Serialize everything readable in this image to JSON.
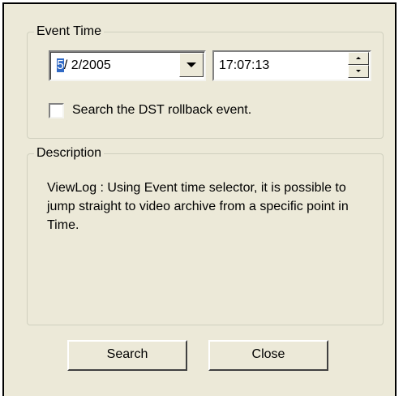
{
  "event_time": {
    "group_label": "Event Time",
    "date": {
      "month": "5",
      "rest": "/ 2/2005"
    },
    "time": "17:07:13",
    "dst_checkbox": {
      "label": "Search the DST rollback event.",
      "checked": false
    }
  },
  "description": {
    "group_label": "Description",
    "text": "ViewLog : Using Event time selector, it is possible to jump straight to video archive from a specific point in Time."
  },
  "buttons": {
    "search_label": "Search",
    "close_label": "Close"
  },
  "colors": {
    "dialog_bg": "#ece9d8",
    "selection": "#316ac5"
  },
  "icons": {
    "date_dropdown": "chevron-down-icon",
    "time_up": "spin-up-icon",
    "time_down": "spin-down-icon"
  }
}
